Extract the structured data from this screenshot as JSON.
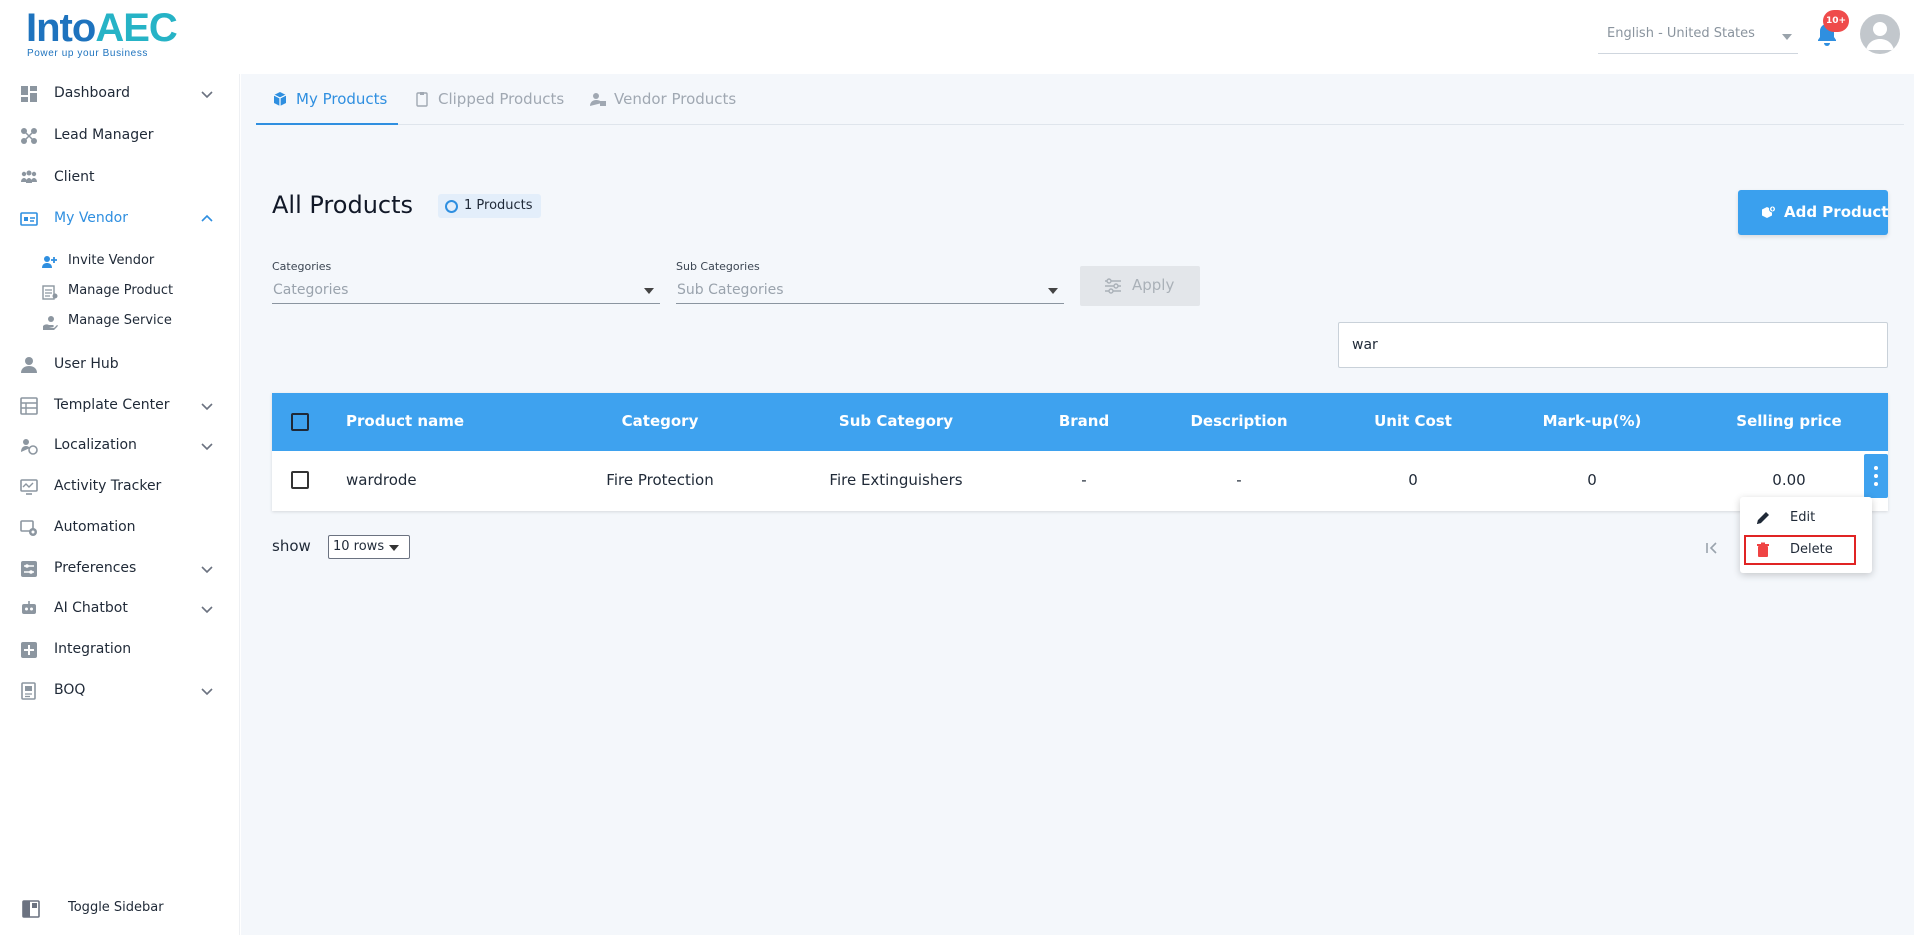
{
  "app": {
    "brand_left": "Into",
    "brand_right": "AEC",
    "tagline": "Power up your Business"
  },
  "header": {
    "language": "English - United States",
    "notification_count": "10+"
  },
  "sidebar": {
    "items": [
      {
        "label": "Dashboard",
        "icon": "dashboard-icon",
        "has_chevron": true
      },
      {
        "label": "Lead Manager",
        "icon": "lead-manager-icon"
      },
      {
        "label": "Client",
        "icon": "client-icon"
      },
      {
        "label": "My Vendor",
        "icon": "vendor-icon",
        "active": true,
        "expanded": true
      },
      {
        "label": "User Hub",
        "icon": "user-icon"
      },
      {
        "label": "Template Center",
        "icon": "template-icon",
        "has_chevron": true
      },
      {
        "label": "Localization",
        "icon": "localization-icon",
        "has_chevron": true
      },
      {
        "label": "Activity Tracker",
        "icon": "activity-icon"
      },
      {
        "label": "Automation",
        "icon": "automation-icon"
      },
      {
        "label": "Preferences",
        "icon": "preferences-icon",
        "has_chevron": true
      },
      {
        "label": "AI Chatbot",
        "icon": "chatbot-icon",
        "has_chevron": true
      },
      {
        "label": "Integration",
        "icon": "integration-icon"
      },
      {
        "label": "BOQ",
        "icon": "boq-icon",
        "has_chevron": true
      }
    ],
    "sub_items": [
      {
        "label": "Invite Vendor",
        "icon": "invite-vendor-icon"
      },
      {
        "label": "Manage Product",
        "icon": "manage-product-icon"
      },
      {
        "label": "Manage Service",
        "icon": "manage-service-icon"
      }
    ],
    "toggle_label": "Toggle Sidebar"
  },
  "tabs": [
    {
      "label": "My Products",
      "icon": "box-icon",
      "active": true
    },
    {
      "label": "Clipped Products",
      "icon": "clip-icon"
    },
    {
      "label": "Vendor Products",
      "icon": "vendor-user-icon"
    }
  ],
  "page": {
    "title": "All Products",
    "count_badge": "1 Products",
    "add_button": "Add Product"
  },
  "filters": {
    "categories_label": "Categories",
    "categories_placeholder": "Categories",
    "subcategories_label": "Sub Categories",
    "subcategories_placeholder": "Sub Categories",
    "apply": "Apply"
  },
  "search": {
    "value": "war"
  },
  "table": {
    "columns": [
      "Product name",
      "Category",
      "Sub Category",
      "Brand",
      "Description",
      "Unit Cost",
      "Mark-up(%)",
      "Selling price"
    ],
    "rows": [
      [
        "wardrode",
        "Fire Protection",
        "Fire Extinguishers",
        "-",
        "-",
        "0",
        "0",
        "0.00"
      ]
    ]
  },
  "pagination": {
    "show_label": "show",
    "rows_option": "10 rows"
  },
  "row_menu": {
    "edit": "Edit",
    "delete": "Delete"
  },
  "colors": {
    "accent": "#3ea2ef",
    "active_text": "#2f8fe0",
    "badge": "#ef4b4b",
    "delete_icon": "#ef4444",
    "highlight_border": "#e02424"
  }
}
